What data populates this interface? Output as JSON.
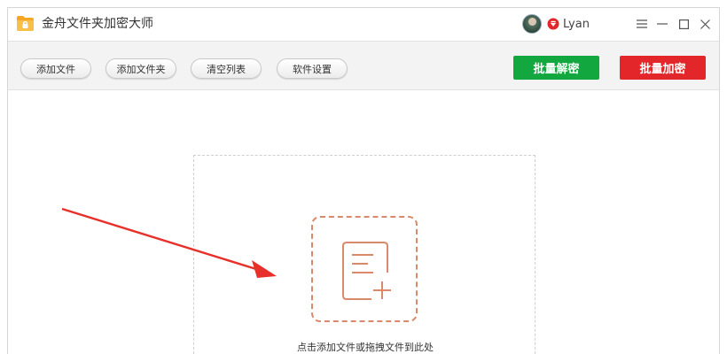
{
  "app": {
    "title": "金舟文件夹加密大师",
    "logo_icon": "folder-lock-icon",
    "accent_color": "#f5a623"
  },
  "user": {
    "name": "Lyan",
    "avatar_icon": "user-avatar",
    "badge_icon": "vip-diamond-icon"
  },
  "window_controls": {
    "menu_icon": "menu-icon",
    "minimize_icon": "minimize-icon",
    "maximize_icon": "maximize-icon",
    "close_icon": "close-icon"
  },
  "toolbar": {
    "add_file_label": "添加文件",
    "add_folder_label": "添加文件夹",
    "clear_list_label": "清空列表",
    "settings_label": "软件设置",
    "batch_decrypt_label": "批量解密",
    "batch_encrypt_label": "批量加密",
    "decrypt_color": "#12a83f",
    "encrypt_color": "#e2262a"
  },
  "main": {
    "drop_hint": "点击添加文件或拖拽文件到此处",
    "drop_icon": "add-file-icon",
    "annotation_color": "#e8302a"
  }
}
